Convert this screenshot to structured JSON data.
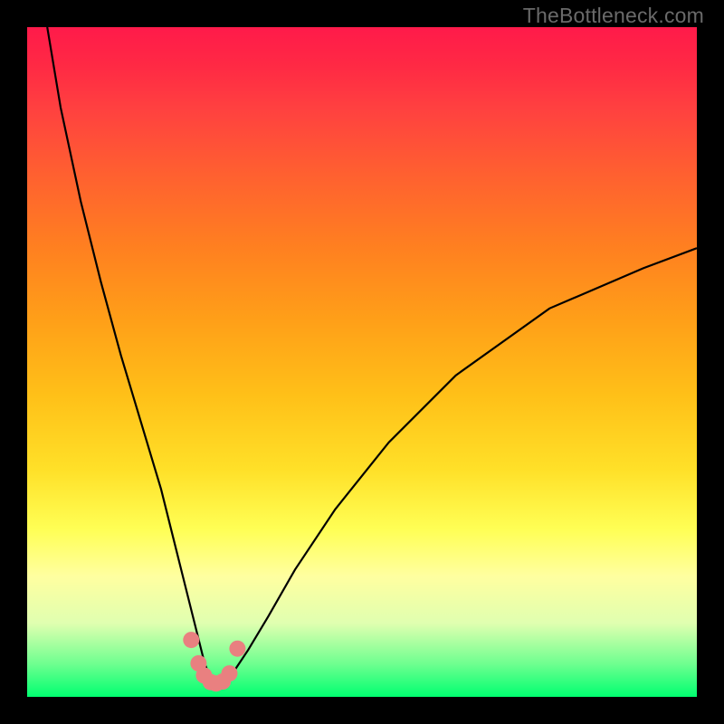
{
  "watermark": "TheBottleneck.com",
  "chart_data": {
    "type": "line",
    "title": "",
    "xlabel": "",
    "ylabel": "",
    "xlim": [
      0,
      100
    ],
    "ylim": [
      0,
      100
    ],
    "grid": false,
    "legend": false,
    "series": [
      {
        "name": "bottleneck-curve",
        "x": [
          3,
          5,
          8,
          11,
          14,
          17,
          20,
          22,
          24,
          25.5,
          26.5,
          27.5,
          28.5,
          29.5,
          31,
          33,
          36,
          40,
          46,
          54,
          64,
          78,
          92,
          100
        ],
        "y": [
          100,
          88,
          74,
          62,
          51,
          41,
          31,
          23,
          15,
          9,
          5,
          2.5,
          2,
          2.5,
          4,
          7,
          12,
          19,
          28,
          38,
          48,
          58,
          64,
          67
        ]
      }
    ],
    "markers": {
      "name": "highlight-dots",
      "x": [
        24.5,
        25.6,
        26.4,
        27.4,
        28.2,
        29.2,
        30.2,
        31.4
      ],
      "y": [
        8.5,
        5.0,
        3.2,
        2.2,
        2.0,
        2.3,
        3.5,
        7.2
      ]
    },
    "colors": {
      "curve": "#000000",
      "markers": "#e98080",
      "bg_top": "#ff1a4a",
      "bg_mid": "#ffff55",
      "bg_bottom": "#00ff70"
    }
  }
}
